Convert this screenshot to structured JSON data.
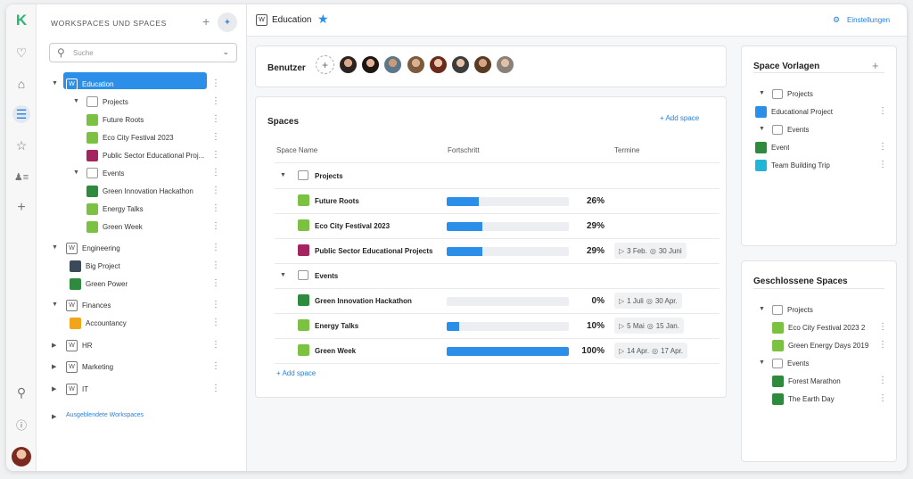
{
  "rail": {
    "icons": [
      "logo-icon",
      "bell-icon",
      "home-icon",
      "spaces-icon",
      "star-icon",
      "users-icon",
      "plus-icon",
      "search-icon",
      "help-icon",
      "avatar"
    ]
  },
  "sidebar": {
    "title": "WORKSPACES UND SPACES",
    "search_placeholder": "Suche",
    "hidden_workspaces": "Ausgeblendete Workspaces",
    "tree": [
      {
        "label": "Education",
        "kind": "workspace",
        "level": 0
      },
      {
        "label": "Projects",
        "kind": "folder",
        "level": 1
      },
      {
        "label": "Future Roots",
        "kind": "space",
        "level": 2,
        "color": "#7cc242"
      },
      {
        "label": "Eco City Festival 2023",
        "kind": "space",
        "level": 2,
        "color": "#7cc242"
      },
      {
        "label": "Public Sector Educational Proj...",
        "kind": "space",
        "level": 2,
        "color": "#a3245e"
      },
      {
        "label": "Events",
        "kind": "folder",
        "level": 1
      },
      {
        "label": "Green Innovation Hackathon",
        "kind": "space",
        "level": 2,
        "color": "#2e8b3d"
      },
      {
        "label": "Energy Talks",
        "kind": "space",
        "level": 2,
        "color": "#7cc242"
      },
      {
        "label": "Green Week",
        "kind": "space",
        "level": 2,
        "color": "#7cc242"
      },
      {
        "label": "Engineering",
        "kind": "workspace",
        "level": 0
      },
      {
        "label": "Big Project",
        "kind": "space",
        "level": 1,
        "color": "#3a4a58"
      },
      {
        "label": "Green Power",
        "kind": "space",
        "level": 1,
        "color": "#2e8b3d"
      },
      {
        "label": "Finances",
        "kind": "workspace",
        "level": 0
      },
      {
        "label": "Accountancy",
        "kind": "space",
        "level": 1,
        "color": "#f2a51a"
      },
      {
        "label": "HR",
        "kind": "workspace",
        "level": 0
      },
      {
        "label": "Marketing",
        "kind": "workspace",
        "level": 0
      },
      {
        "label": "IT",
        "kind": "workspace",
        "level": 0
      }
    ]
  },
  "header": {
    "workspace_badge": "W",
    "title": "Education",
    "settings": "Einstellungen"
  },
  "users": {
    "title": "Benutzer",
    "add": "+"
  },
  "spaces": {
    "title": "Spaces",
    "add_top": "+ Add space",
    "add_bottom": "+ Add space",
    "columns": [
      "Space Name",
      "Fortschritt",
      "Termine"
    ],
    "rows": [
      {
        "type": "folder",
        "name": "Projects"
      },
      {
        "type": "space",
        "name": "Future Roots",
        "progress": 26,
        "pct": "26%",
        "color": "#7cc242",
        "start": "",
        "end": ""
      },
      {
        "type": "space",
        "name": "Eco City Festival 2023",
        "progress": 29,
        "pct": "29%",
        "color": "#7cc242",
        "start": "",
        "end": ""
      },
      {
        "type": "space",
        "name": "Public Sector Educational Projects",
        "progress": 29,
        "pct": "29%",
        "color": "#a3245e",
        "start": "3 Feb.",
        "end": "30 Juni"
      },
      {
        "type": "folder",
        "name": "Events"
      },
      {
        "type": "space",
        "name": "Green Innovation Hackathon",
        "progress": 0,
        "pct": "0%",
        "color": "#2e8b3d",
        "start": "1 Juli",
        "end": "30 Apr."
      },
      {
        "type": "space",
        "name": "Energy Talks",
        "progress": 10,
        "pct": "10%",
        "color": "#7cc242",
        "start": "5 Mai",
        "end": "15 Jan."
      },
      {
        "type": "space",
        "name": "Green Week",
        "progress": 100,
        "pct": "100%",
        "color": "#7cc242",
        "start": "14 Apr.",
        "end": "17 Apr."
      }
    ]
  },
  "templates": {
    "title": "Space Vorlagen",
    "add": "+",
    "items": [
      {
        "label": "Projects",
        "kind": "folder"
      },
      {
        "label": "Educational Project",
        "kind": "space",
        "color": "#2b8fe9"
      },
      {
        "label": "Events",
        "kind": "folder"
      },
      {
        "label": "Event",
        "kind": "space",
        "color": "#2e8b3d"
      },
      {
        "label": "Team Building Trip",
        "kind": "space",
        "color": "#22b5d6"
      }
    ]
  },
  "closed": {
    "title": "Geschlossene Spaces",
    "items": [
      {
        "label": "Projects",
        "kind": "folder"
      },
      {
        "label": "Eco City Festival 2023 2",
        "kind": "space",
        "color": "#7cc242"
      },
      {
        "label": "Green Energy Days 2019",
        "kind": "space",
        "color": "#7cc242"
      },
      {
        "label": "Events",
        "kind": "folder"
      },
      {
        "label": "Forest Marathon",
        "kind": "space",
        "color": "#2e8b3d"
      },
      {
        "label": "The Earth Day",
        "kind": "space",
        "color": "#2e8b3d"
      }
    ]
  }
}
